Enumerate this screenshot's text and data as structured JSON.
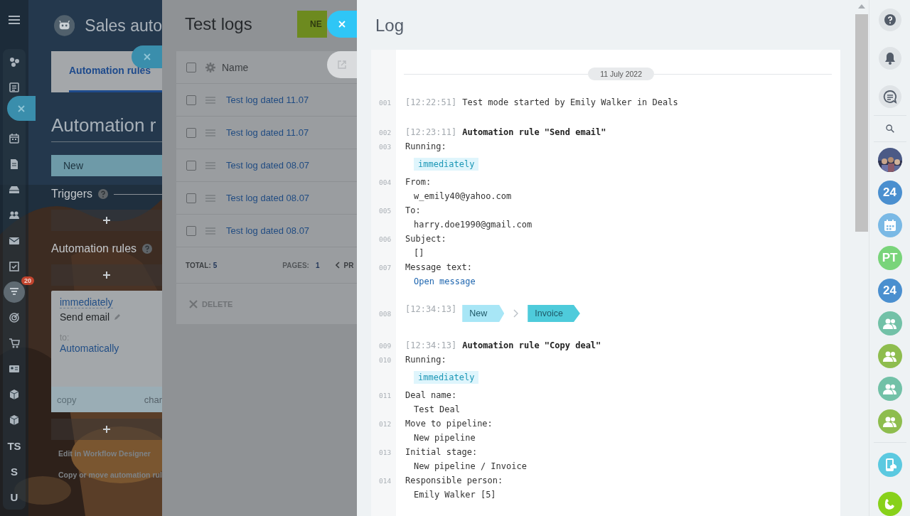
{
  "left_nav": {
    "items": [
      {
        "kind": "icon",
        "selected": false
      },
      {
        "kind": "icon",
        "selected": false
      },
      {
        "kind": "icon",
        "selected": false
      },
      {
        "kind": "icon",
        "selected": false
      },
      {
        "kind": "icon",
        "selected": false
      },
      {
        "kind": "icon",
        "selected": false
      },
      {
        "kind": "icon",
        "selected": false
      },
      {
        "kind": "icon",
        "selected": false
      },
      {
        "kind": "icon",
        "selected": true,
        "badge": "20"
      },
      {
        "kind": "icon",
        "selected": false
      },
      {
        "kind": "icon",
        "selected": false
      },
      {
        "kind": "icon",
        "selected": false
      },
      {
        "kind": "icon",
        "selected": false
      },
      {
        "kind": "icon",
        "selected": false
      },
      {
        "kind": "text",
        "label": "TS",
        "selected": false
      },
      {
        "kind": "text",
        "label": "S",
        "selected": false
      },
      {
        "kind": "text",
        "label": "U",
        "selected": false
      }
    ]
  },
  "background_page": {
    "title": "Sales auto",
    "tabs": [
      {
        "label": "Automation rules",
        "selected": true
      }
    ],
    "heading": "Automation r",
    "stage": "New",
    "triggers_label": "Triggers",
    "rules_label": "Automation rules",
    "rule_card": {
      "timing": "immediately",
      "name": "Send email",
      "to_label": "to:",
      "to_value": "Automatically",
      "footer_left": "copy",
      "footer_right": "char"
    },
    "links": [
      "Edit in Workflow Designer",
      "Copy or move automation rul"
    ]
  },
  "test_logs": {
    "title": "Test logs",
    "new_button": "NE",
    "select_all": {
      "checked": false
    },
    "columns": [
      {
        "label": "Name"
      }
    ],
    "rows": [
      {
        "name": "Test log dated 11.07",
        "checked": false
      },
      {
        "name": "Test log dated 11.07",
        "checked": false
      },
      {
        "name": "Test log dated 08.07",
        "checked": false
      },
      {
        "name": "Test log dated 08.07",
        "checked": false
      },
      {
        "name": "Test log dated 08.07",
        "checked": false
      }
    ],
    "total_label": "TOTAL:",
    "total": "5",
    "pages_label": "PAGES:",
    "pages": "1",
    "prev": "PR",
    "delete": "DELETE"
  },
  "log": {
    "title": "Log",
    "date": "11 July 2022",
    "entries": [
      {
        "lines": [
          {
            "kind": "event",
            "number": "001",
            "time": "[12:22:51]",
            "text": "Test mode started by Emily Walker in Deals"
          }
        ]
      },
      {
        "lines": [
          {
            "kind": "rule",
            "number": "002",
            "time": "[12:23:11]",
            "text": "Automation rule \"Send email\""
          },
          {
            "kind": "label",
            "number": "003",
            "text": "Running:"
          },
          {
            "kind": "tag",
            "text": "immediately"
          },
          {
            "kind": "label",
            "number": "004",
            "text": "From:"
          },
          {
            "kind": "value",
            "text": "w_emily40@yahoo.com"
          },
          {
            "kind": "label",
            "number": "005",
            "text": "To:"
          },
          {
            "kind": "value",
            "text": "harry.doe1990@gmail.com"
          },
          {
            "kind": "label",
            "number": "006",
            "text": "Subject:"
          },
          {
            "kind": "value",
            "text": "[]"
          },
          {
            "kind": "label",
            "number": "007",
            "text": "Message text:"
          },
          {
            "kind": "link",
            "text": "Open message"
          }
        ]
      },
      {
        "lines": [
          {
            "kind": "stages",
            "number": "008",
            "time": "[12:34:13]",
            "stages": [
              {
                "label": "New",
                "color": "#a8e6f6"
              },
              {
                "label": "Invoice",
                "color": "#4ecbdb"
              }
            ]
          }
        ]
      },
      {
        "lines": [
          {
            "kind": "rule",
            "number": "009",
            "time": "[12:34:13]",
            "text": "Automation rule \"Copy deal\""
          },
          {
            "kind": "label",
            "number": "010",
            "text": "Running:"
          },
          {
            "kind": "tag",
            "text": "immediately"
          },
          {
            "kind": "label",
            "number": "011",
            "text": "Deal name:"
          },
          {
            "kind": "value",
            "text": "Test Deal"
          },
          {
            "kind": "label",
            "number": "012",
            "text": "Move to pipeline:"
          },
          {
            "kind": "value",
            "text": "New pipeline"
          },
          {
            "kind": "label",
            "number": "013",
            "text": "Initial stage:"
          },
          {
            "kind": "value",
            "text": "New pipeline / Invoice"
          },
          {
            "kind": "label",
            "number": "014",
            "text": "Responsible person:"
          },
          {
            "kind": "value",
            "text": "Emily Walker [5]"
          }
        ]
      }
    ]
  },
  "right_bar": {
    "contacts": [
      {
        "kind": "picture"
      },
      {
        "kind": "text",
        "label": "24",
        "color": "#4a8fcf"
      },
      {
        "kind": "calendar",
        "color": "#7ab9e5"
      },
      {
        "kind": "text",
        "label": "PT",
        "color": "#79d47a"
      },
      {
        "kind": "text",
        "label": "24",
        "color": "#4a8fcf"
      },
      {
        "kind": "group",
        "color": "#72c1a7"
      },
      {
        "kind": "group",
        "color": "#8ebd4e"
      },
      {
        "kind": "group",
        "color": "#72c1a7"
      },
      {
        "kind": "group",
        "color": "#8ebd4e"
      }
    ]
  }
}
